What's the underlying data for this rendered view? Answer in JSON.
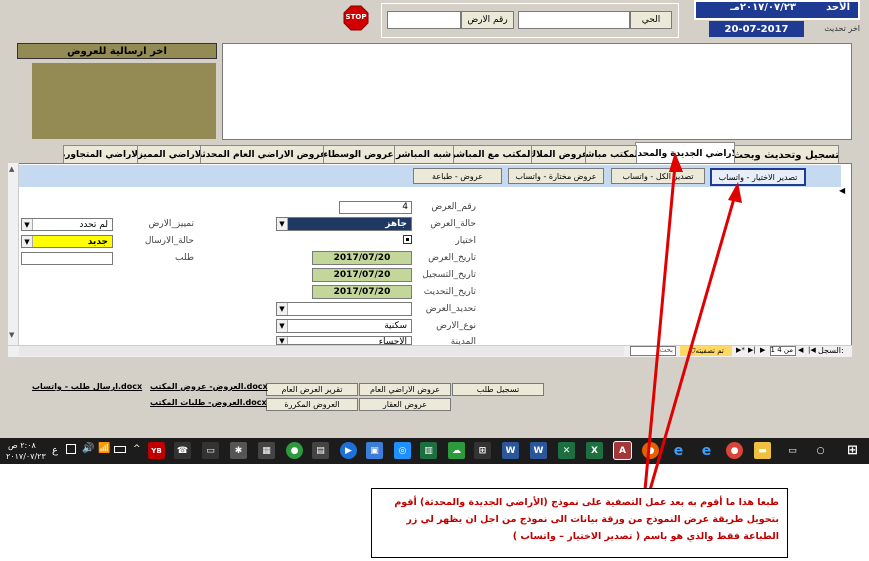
{
  "header": {
    "day_label": "الأحد",
    "hijri_date": "٢٠١٧/٠٧/٢٣مـ",
    "last_update_label": "اخر تحديث",
    "last_update_value": "20-07-2017",
    "stop_label": "STOP",
    "district_button": "الحي",
    "plot_button": "رقم الارض"
  },
  "last_sent": {
    "label": "اخر ارسالية للعروض"
  },
  "tabs": [
    "تسجيل وتحديث وبحث",
    "الاراضي الجديدة والمحدثة",
    "المكتب مباشر",
    "عروض الملاك",
    "المكتب مع المباشر",
    "شبه المباشر",
    "عروض الوسطاء",
    "عروض الاراضي العام المحدثة",
    "الاراضي المميزة",
    "الاراضي المتجاورة"
  ],
  "subform": {
    "buttons": {
      "export_selection": "تصدير الاختيار - واتساب",
      "export_all": "تصدير الكل - واتساب",
      "selected_offers": "عروض مختارة - واتساب",
      "print_offers": "عروض - طباعة"
    },
    "fields": {
      "offer_number_label": "رقم_العرض",
      "offer_number_value": "4",
      "offer_status_label": "حالة_العرض",
      "offer_status_value": "جاهز",
      "selection_label": "اختيار",
      "offer_date_label": "تاريخ_العرض",
      "offer_date_value": "2017/07/20",
      "register_date_label": "تاريخ_التسجيل",
      "register_date_value": "2017/07/20",
      "update_date_label": "تاريخ_التحديث",
      "update_date_value": "2017/07/20",
      "offer_type_label": "تحديد_العرض",
      "land_type_label": "نوع_الارض",
      "land_type_value": "سكنية",
      "city_label": "المدينة",
      "city_value": "الاحساء",
      "land_class_label": "تمييز_الارض",
      "land_class_value": "لم تحدد",
      "send_status_label": "حالة_الارسال",
      "send_status_value": "جديد",
      "request_label": "طلب"
    },
    "nav": {
      "record_label": "السجل:",
      "record_value": "1 من 4",
      "filter_label": "تم تصفيته",
      "search_label": "بحث"
    }
  },
  "bottom_buttons": {
    "register_request": "تسجيل طلب",
    "public_land_offers": "عروض الاراضي العام",
    "public_offer_report": "تقرير العرض العام",
    "property_offers": "عروض العقار",
    "repeated_offers": "العروض المكررة"
  },
  "bottom_links": {
    "send_request": "ارسال طلب - واتساب.docx",
    "office_offers": "العروض- عروض المكتب.docx",
    "office_requests": "العروض- طلبات المكتب.docx"
  },
  "taskbar": {
    "time": "٢:٠٨ ص",
    "date": "٢٠١٧/٠٧/٢٣",
    "lang": "ع"
  },
  "annotation": {
    "text": "طبعا هذا ما أقوم به بعد عمل التصفية على نموذج (الأراضي الجديدة والمحدثة) أقوم بتحويل طريقة عرض النموذج من ورقة بيانات الى نموذج من اجل ان يظهر لي زر الطباعة فقط والذي هو باسم ( تصدير الاختيار – واتساب )",
    "color": "#c00000"
  }
}
